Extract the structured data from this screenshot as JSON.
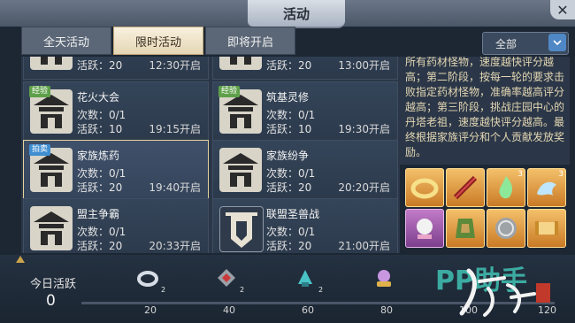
{
  "window": {
    "title": "活动",
    "close_symbol": "✕"
  },
  "tabs": [
    {
      "label": "全天活动",
      "active": false
    },
    {
      "label": "限时活动",
      "active": true
    },
    {
      "label": "即将开启",
      "active": false
    }
  ],
  "filter": {
    "selected": "全部",
    "caret_icon": "chevron-down-icon"
  },
  "activities": [
    {
      "name": "",
      "badge": "",
      "times": "",
      "active": "活跃：20",
      "start": "12:30开启"
    },
    {
      "name": "",
      "badge": "",
      "times": "",
      "active": "活跃：20",
      "start": "13:00开启"
    },
    {
      "name": "花火大会",
      "badge": "经验",
      "times": "次数：0/1",
      "active": "活跃：10",
      "start": "19:15开启"
    },
    {
      "name": "筑基灵修",
      "badge": "经验",
      "times": "次数：0/1",
      "active": "活跃：10",
      "start": "19:30开启"
    },
    {
      "name": "家族炼药",
      "badge": "拍卖",
      "times": "次数：0/1",
      "active": "活跃：20",
      "start": "19:40开启",
      "selected": true
    },
    {
      "name": "家族纷争",
      "badge": "",
      "times": "次数：0/1",
      "active": "活跃：20",
      "start": "20:20开启"
    },
    {
      "name": "盟主争霸",
      "badge": "",
      "times": "次数：0/1",
      "active": "活跃：20",
      "start": "20:33开启"
    },
    {
      "name": "联盟圣兽战",
      "badge": "",
      "times": "次数：0/1",
      "active": "活跃：20",
      "start": "21:00开启"
    }
  ],
  "description": "所有药材怪物，速度越快评分越高；第二阶段，按每一轮的要求击败指定药材怪物，准确率越高评分越高；第三阶段，挑战庄园中心的丹塔老祖，速度越快评分越高。最终根据家族评分和个人贡献发放奖励。",
  "rewards": [
    {
      "icon": "gold-ring-icon",
      "color": "orange",
      "lock": ""
    },
    {
      "icon": "red-sword-icon",
      "color": "orange",
      "lock": ""
    },
    {
      "icon": "green-flame-icon",
      "color": "orange",
      "lock": "3"
    },
    {
      "icon": "blue-spirit-icon",
      "color": "orange",
      "lock": "3"
    },
    {
      "icon": "white-pearl-icon",
      "color": "purple",
      "lock": ""
    },
    {
      "icon": "jade-token-icon",
      "color": "orange",
      "lock": ""
    },
    {
      "icon": "silver-coin-icon",
      "color": "orange",
      "lock": ""
    },
    {
      "icon": "gold-scroll-icon",
      "color": "orange",
      "lock": ""
    }
  ],
  "daily": {
    "label": "今日活跃",
    "value": "0",
    "milestones": [
      "20",
      "40",
      "60",
      "80",
      "100",
      "120"
    ],
    "chest_counts": [
      "2",
      "2",
      "2"
    ]
  },
  "watermark": "PP助手"
}
